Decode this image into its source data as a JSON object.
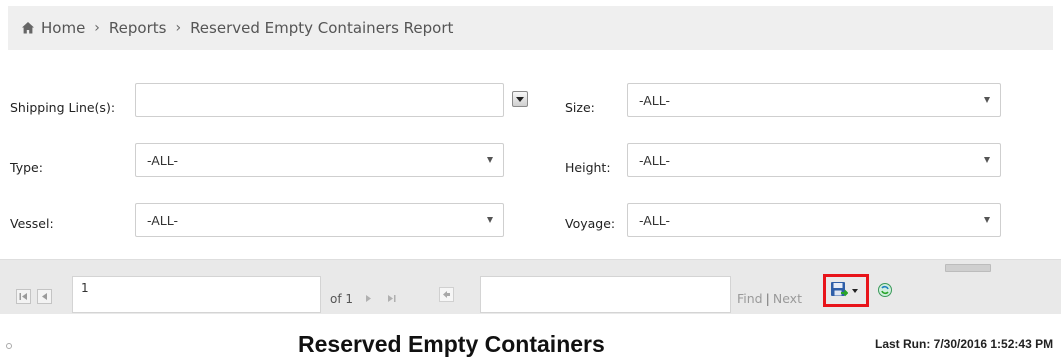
{
  "breadcrumb": {
    "home": "Home",
    "separator": "›",
    "reports": "Reports",
    "current": "Reserved Empty Containers Report"
  },
  "params": {
    "shipping_lines": {
      "label": "Shipping Line(s):",
      "value": ""
    },
    "size": {
      "label": "Size:",
      "value": "-ALL-"
    },
    "type": {
      "label": "Type:",
      "value": "-ALL-"
    },
    "height": {
      "label": "Height:",
      "value": "-ALL-"
    },
    "vessel": {
      "label": "Vessel:",
      "value": "-ALL-"
    },
    "voyage": {
      "label": "Voyage:",
      "value": "-ALL-"
    }
  },
  "toolbar": {
    "page_value": "1",
    "page_of": "of 1",
    "find_value": "",
    "find_label": "Find",
    "find_separator": "|",
    "next_label": "Next"
  },
  "report": {
    "title": "Reserved Empty Containers",
    "last_run": "Last Run: 7/30/2016 1:52:43 PM"
  },
  "colors": {
    "highlight": "#e8141a",
    "toolbar_bg": "#e9e9e9",
    "breadcrumb_bg": "#efefef"
  },
  "icons": [
    "home-icon",
    "first-page-icon",
    "previous-page-icon",
    "next-page-icon",
    "last-page-icon",
    "back-to-parent-icon",
    "export-save-icon",
    "refresh-icon"
  ]
}
